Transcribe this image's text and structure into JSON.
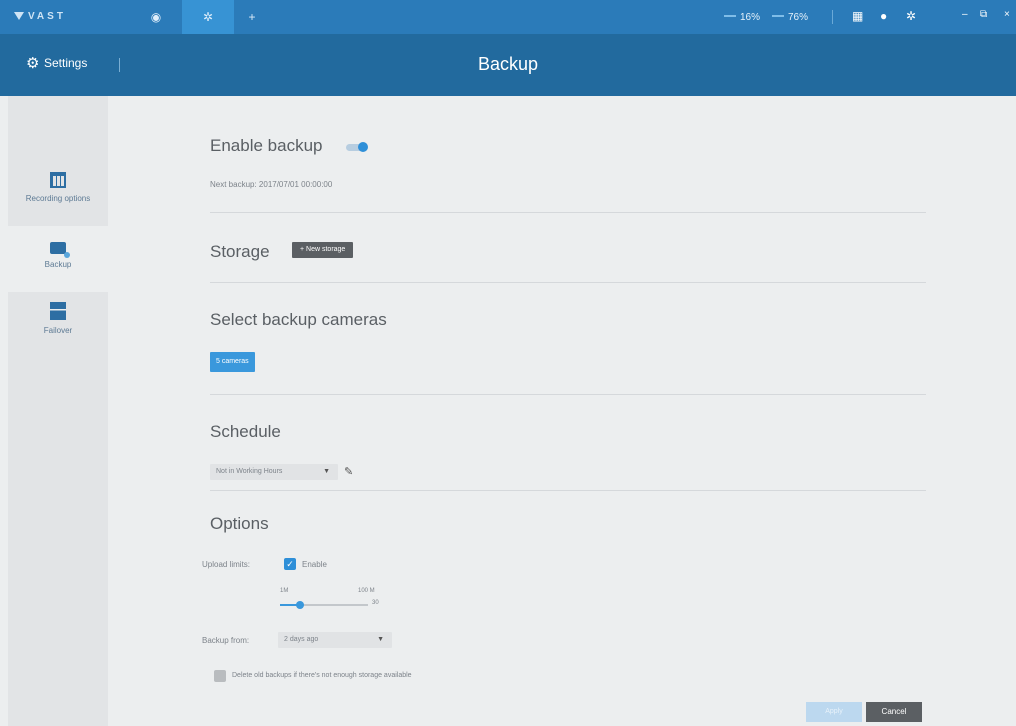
{
  "topbar": {
    "logo": "VAST",
    "tabs": [
      {
        "icon": "eye-icon",
        "glyph": "◉"
      },
      {
        "icon": "gear-icon",
        "glyph": "✲"
      },
      {
        "icon": "plus-icon",
        "glyph": "+"
      }
    ],
    "cpu": "16%",
    "memory": "76%"
  },
  "header": {
    "breadcrumb": "Settings",
    "title": "Backup"
  },
  "sidebar": {
    "items": [
      {
        "label": "Recording options",
        "icon": "calendar-icon"
      },
      {
        "label": "Backup",
        "icon": "hard-drive-icon"
      },
      {
        "label": "Failover",
        "icon": "failover-icon"
      }
    ]
  },
  "enable_backup": {
    "title": "Enable backup",
    "enabled": true,
    "next_backup": "Next backup: 2017/07/01 00:00:00"
  },
  "storage": {
    "title": "Storage",
    "new_storage_label": "+ New storage"
  },
  "cameras": {
    "title": "Select backup cameras",
    "button_label": "5 cameras"
  },
  "schedule": {
    "title": "Schedule",
    "selected": "Not in Working Hours"
  },
  "options": {
    "title": "Options",
    "upload_limits_label": "Upload limits:",
    "enable_label": "Enable",
    "enable_checked": true,
    "slider_min_label": "1M",
    "slider_max_label": "100 M",
    "slider_value_label": "30",
    "backup_from_label": "Backup from:",
    "backup_from_selected": "2 days ago",
    "delete_old_label": "Delete old backups if there's not enough storage available",
    "delete_old_checked": false
  },
  "footer": {
    "apply_label": "Apply",
    "cancel_label": "Cancel"
  },
  "colors": {
    "topbar": "#2b7bb9",
    "header": "#226a9e",
    "accent": "#2e8fd8",
    "background": "#eceeef"
  }
}
